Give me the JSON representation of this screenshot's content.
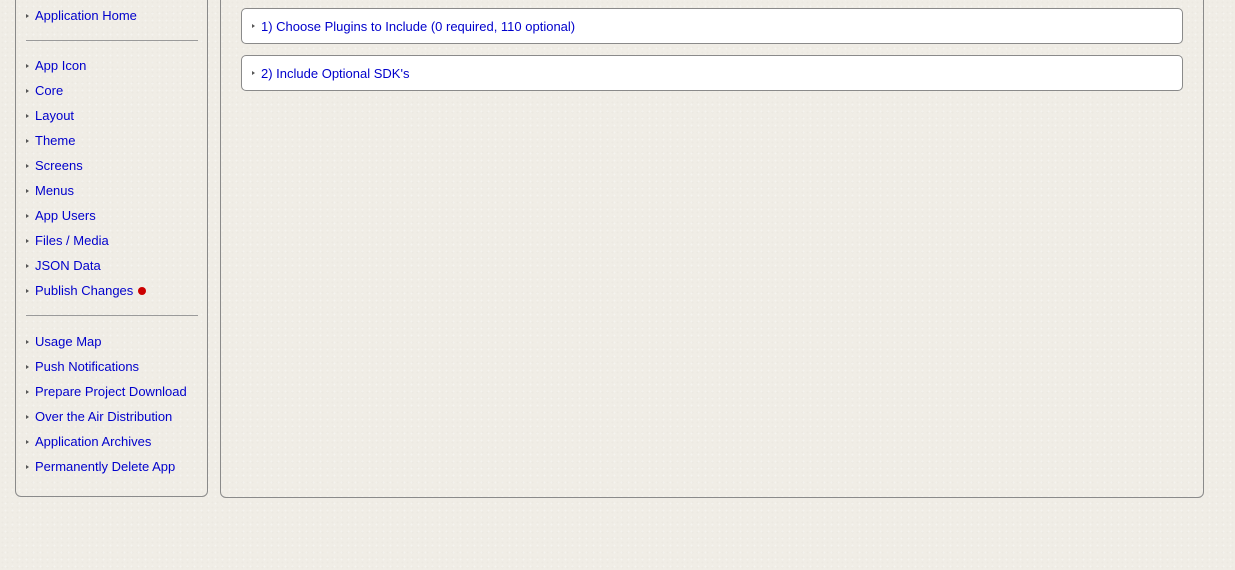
{
  "sidebar": {
    "top_item": "Application Home",
    "group1": [
      "App Icon",
      "Core",
      "Layout",
      "Theme",
      "Screens",
      "Menus",
      "App Users",
      "Files / Media",
      "JSON Data",
      "Publish Changes"
    ],
    "group2": [
      "Usage Map",
      "Push Notifications",
      "Prepare Project Download",
      "Over the Air Distribution",
      "Application Archives",
      "Permanently Delete App"
    ],
    "publish_indicator_color": "#cc0000"
  },
  "main": {
    "sections": [
      "1) Choose Plugins to Include (0 required, 110 optional)",
      "2) Include Optional SDK's"
    ]
  },
  "colors": {
    "link": "#0000cc",
    "background": "#f0ede6",
    "border": "#8a8a8a"
  }
}
